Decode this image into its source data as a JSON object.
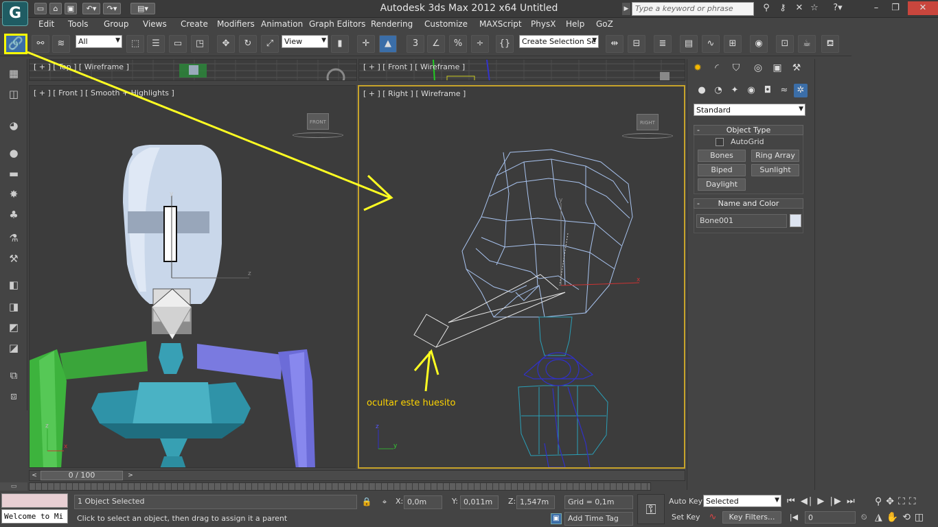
{
  "app": {
    "title": "Autodesk 3ds Max  2012 x64     Untitled"
  },
  "titlebar": {
    "search_placeholder": "Type a keyword or phrase"
  },
  "menu": [
    "Edit",
    "Tools",
    "Group",
    "Views",
    "Create",
    "Modifiers",
    "Animation",
    "Graph Editors",
    "Rendering",
    "Customize",
    "MAXScript",
    "PhysX",
    "Help",
    "GoZ"
  ],
  "toolbar": {
    "filter_value": "All",
    "refcoord_value": "View",
    "named_selection_value": "Create Selection Se"
  },
  "viewports": {
    "top_left_label": "[ + ] [ Top ] [ Wireframe ]",
    "top_right_label": "[ + ] [ Front ] [ Wireframe ]",
    "front_label": "[ + ] [ Front ] [ Smooth + Highlights ]",
    "right_label": "[ + ] [ Right ] [ Wireframe ]",
    "front_cube": "FRONT",
    "right_cube": "RIGHT"
  },
  "annotation": {
    "text": "ocultar este huesito"
  },
  "command_panel": {
    "category_value": "Standard",
    "object_type_title": "Object Type",
    "autogrid_label": "AutoGrid",
    "buttons": [
      "Bones",
      "Ring Array",
      "Biped",
      "Sunlight",
      "Daylight"
    ],
    "name_color_title": "Name and Color",
    "name_value": "Bone001"
  },
  "timeline": {
    "frame_display": "0 / 100"
  },
  "status": {
    "maxscript_listener": "Welcome to Mi",
    "selection_info": "1 Object Selected",
    "prompt": "Click to select an object, then drag to assign it a parent",
    "x_label": "X:",
    "x_value": "0,0m",
    "y_label": "Y:",
    "y_value": "0,011m",
    "z_label": "Z:",
    "z_value": "1,547m",
    "grid": "Grid = 0,1m",
    "add_time_tag": "Add Time Tag",
    "auto_key": "Auto Key",
    "set_key": "Set Key",
    "key_mode_value": "Selected",
    "key_filters": "Key Filters...",
    "current_frame": "0"
  }
}
